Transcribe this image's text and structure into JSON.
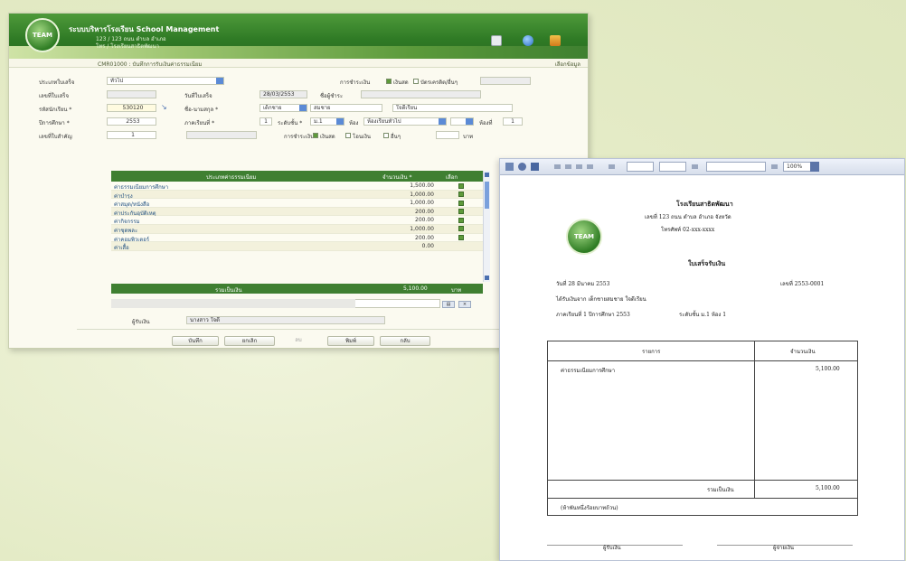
{
  "app": {
    "title": "ระบบบริหารโรงเรียน School Management",
    "subtitle1": "123 / 123 ถนน ตำบล อำเภอ",
    "subtitle2": "โทร / โรงเรียนสาธิตพัฒนา",
    "logo_text": "TEAM",
    "breadcrumb": "CMR01000 : บันทึกการรับเงินค่าธรรมเนียม",
    "breadcrumb_right": "เลือกข้อมูล"
  },
  "form": {
    "row1": {
      "label": "ประเภทใบเสร็จ",
      "value": "ทั่วไป",
      "label2": "การชำระเงิน",
      "opt1": "เงินสด",
      "opt2": "บัตรเครดิต/อื่นๆ"
    },
    "row2": {
      "label": "เลขที่ใบเสร็จ",
      "label2": "วันที่ใบเสร็จ",
      "date": "28/03/2553",
      "label3": "ชื่อผู้ชำระ"
    },
    "row3": {
      "label": "รหัสนักเรียน *",
      "value": "530120",
      "label2": "ชื่อ-นามสกุล *",
      "prefix": "เด็กชาย",
      "name": "สมชาย",
      "surname": "ใจดีเรียน"
    },
    "row4": {
      "label": "ปีการศึกษา *",
      "value": "2553",
      "label2": "ภาคเรียนที่ *",
      "term": "1",
      "label3": "ระดับชั้น *",
      "level": "ม.1",
      "label4": "ห้อง",
      "room_type": "ห้องเรียนทั่วไป",
      "label5": "ห้องที่",
      "room": "1"
    },
    "row5": {
      "label": "เลขที่ใบสำคัญ",
      "value": "1",
      "label2": "การชำระเงิน",
      "opt1": "เงินสด",
      "opt2": "โอนเงิน",
      "opt3": "อื่นๆ",
      "label3": "บาท"
    }
  },
  "table": {
    "headers": {
      "name": "ประเภทค่าธรรมเนียม",
      "amount": "จำนวนเงิน *",
      "select": "เลือก"
    },
    "rows": [
      {
        "name": "ค่าธรรมเนียมการศึกษา",
        "amount": "1,500.00",
        "selected": true
      },
      {
        "name": "ค่าบำรุง",
        "amount": "1,000.00",
        "selected": true
      },
      {
        "name": "ค่าสมุด/หนังสือ",
        "amount": "1,000.00",
        "selected": true
      },
      {
        "name": "ค่าประกันอุบัติเหตุ",
        "amount": "200.00",
        "selected": true
      },
      {
        "name": "ค่ากิจกรรม",
        "amount": "200.00",
        "selected": true
      },
      {
        "name": "ค่าชุดพละ",
        "amount": "1,000.00",
        "selected": true
      },
      {
        "name": "ค่าคอมพิวเตอร์",
        "amount": "200.00",
        "selected": true
      },
      {
        "name": "ค่าเสื้อ",
        "amount": "0.00",
        "selected": false
      }
    ],
    "total_label": "รวมเป็นเงิน",
    "total_value": "5,100.00",
    "total_unit": "บาท"
  },
  "form_bottom": {
    "label": "ผู้รับเงิน",
    "value": "นางสาว ใจดี"
  },
  "buttons": {
    "save": "บันทึก",
    "cancel": "ยกเลิก",
    "delete": "ลบ",
    "print": "พิมพ์",
    "back": "กลับ"
  },
  "preview": {
    "zoom": "100%",
    "logo_text": "TEAM",
    "school": "โรงเรียนสาธิตพัฒนา",
    "address": "เลขที่ 123 ถนน ตำบล อำเภอ จังหวัด",
    "phone": "โทรศัพท์ 02-xxx-xxxx",
    "title": "ใบเสร็จรับเงิน",
    "date": "วันที่ 28 มีนาคม 2553",
    "receipt_no": "เลขที่ 2553-0001",
    "student": "ได้รับเงินจาก เด็กชายสมชาย ใจดีเรียน",
    "term_info": "ภาคเรียนที่ 1 ปีการศึกษา 2553",
    "desc_note": "ระดับชั้น ม.1 ห้อง 1",
    "col_desc": "รายการ",
    "col_amount": "จำนวนเงิน",
    "item1": "ค่าธรรมเนียมการศึกษา",
    "item1_amount": "5,100.00",
    "total_label": "รวมเป็นเงิน",
    "total_value": "5,100.00",
    "amount_words": "(ห้าพันหนึ่งร้อยบาทถ้วน)",
    "sign1": "ผู้รับเงิน",
    "sign2": "ผู้จ่ายเงิน"
  }
}
